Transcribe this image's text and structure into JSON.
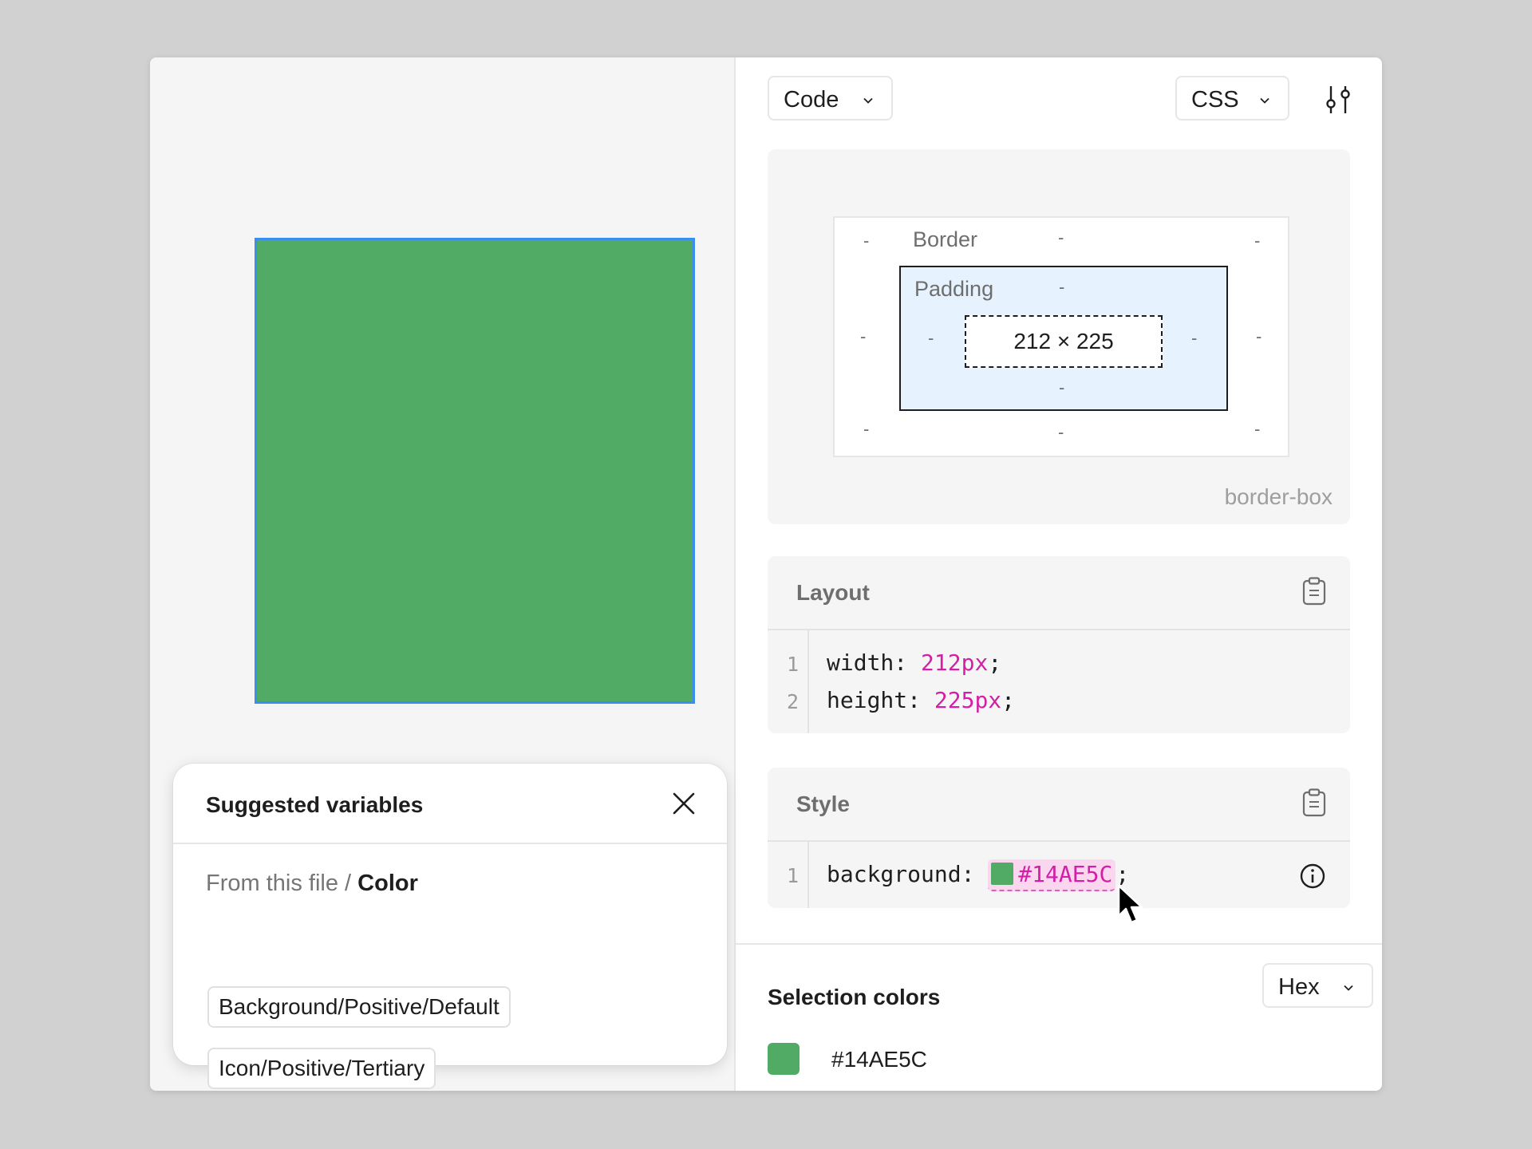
{
  "canvas": {
    "frame_color": "#51AB65",
    "selection_color": "#3B8EF0"
  },
  "suggested_variables": {
    "title": "Suggested variables",
    "path_prefix": "From this file /",
    "path_current": "Color",
    "items": [
      {
        "label": "Background/Positive/Default"
      },
      {
        "label": "Icon/Positive/Tertiary"
      }
    ]
  },
  "toolbar": {
    "mode_label": "Code",
    "language_label": "CSS"
  },
  "box_model": {
    "border_label": "Border",
    "padding_label": "Padding",
    "dash": "-",
    "content_size": "212 × 225",
    "box_sizing": "border-box"
  },
  "layout_section": {
    "title": "Layout",
    "lines": [
      {
        "num": "1",
        "prop": "width:",
        "value": "212px",
        "end": ";"
      },
      {
        "num": "2",
        "prop": "height:",
        "value": "225px",
        "end": ";"
      }
    ]
  },
  "style_section": {
    "title": "Style",
    "lines": [
      {
        "num": "1",
        "prop": "background:",
        "value": "#14AE5C",
        "end": ";"
      }
    ]
  },
  "selection_colors": {
    "title": "Selection colors",
    "format_label": "Hex",
    "items": [
      {
        "hex": "#14AE5C",
        "swatch": "#51AB65"
      }
    ]
  },
  "colors": {
    "accent_pink": "#D21FA8",
    "swatch_green": "#51AB65"
  }
}
